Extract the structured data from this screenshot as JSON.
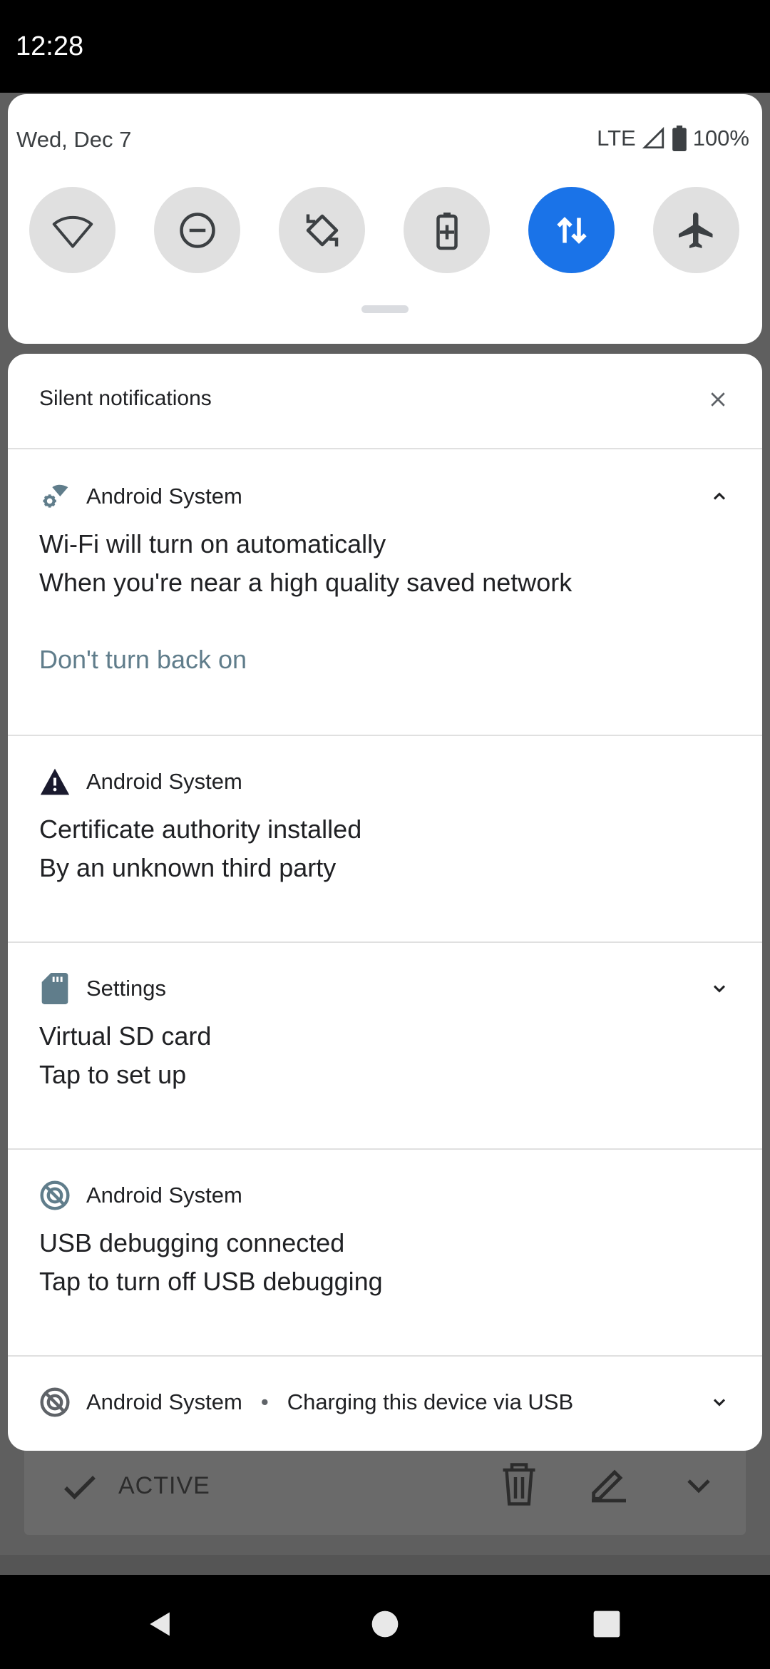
{
  "status_bar": {
    "time": "12:28"
  },
  "quick_settings": {
    "date": "Wed, Dec 7",
    "network_type": "LTE",
    "battery": "100%",
    "tiles": [
      {
        "icon": "wifi-icon",
        "state": "off"
      },
      {
        "icon": "do-not-disturb-icon",
        "state": "off"
      },
      {
        "icon": "auto-rotate-icon",
        "state": "off"
      },
      {
        "icon": "battery-saver-icon",
        "state": "off"
      },
      {
        "icon": "mobile-data-icon",
        "state": "on"
      },
      {
        "icon": "airplane-mode-icon",
        "state": "off"
      }
    ],
    "colors": {
      "tile_on": "#1a73e8",
      "tile_off": "#e0e0e0"
    }
  },
  "shade": {
    "section_title": "Silent notifications",
    "notifications": [
      {
        "icon": "wifi-settings-icon",
        "app": "Android System",
        "expanded": true,
        "title": "Wi-Fi will turn on automatically",
        "text": "When you're near a high quality saved network",
        "action": "Don't turn back on"
      },
      {
        "icon": "warning-icon",
        "app": "Android System",
        "title": "Certificate authority installed",
        "text": "By an unknown third party"
      },
      {
        "icon": "sd-card-icon",
        "app": "Settings",
        "expanded": false,
        "title": "Virtual SD card",
        "text": "Tap to set up"
      },
      {
        "icon": "usb-debug-icon",
        "app": "Android System",
        "title": "USB debugging connected",
        "text": "Tap to turn off USB debugging"
      },
      {
        "icon": "usb-debug-icon",
        "app": "Android System",
        "subtext": "Charging this device via USB",
        "expanded": false
      }
    ],
    "action_color": "#607d8b"
  },
  "background_app": {
    "status_label": "ACTIVE"
  }
}
